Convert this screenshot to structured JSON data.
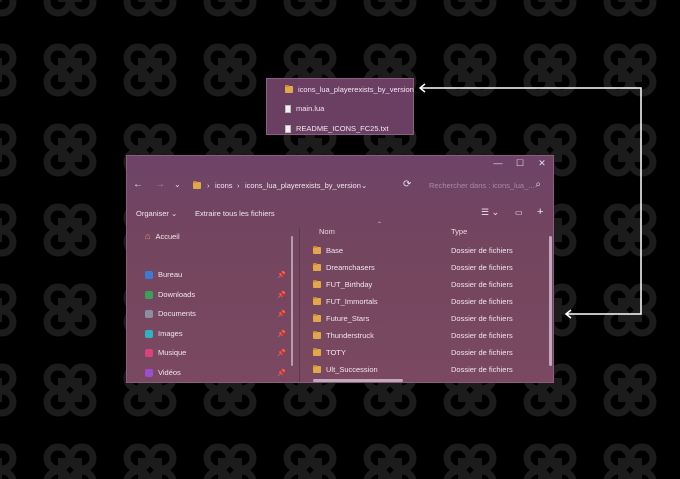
{
  "popup": {
    "items": [
      {
        "name": "icons_lua_playerexists_by_version",
        "icon": "folder-icon"
      },
      {
        "name": "main.lua",
        "icon": "file-icon"
      },
      {
        "name": "README_ICONS_FC25.txt",
        "icon": "file-icon"
      }
    ]
  },
  "window": {
    "breadcrumb": [
      "icons",
      "icons_lua_playerexists_by_version"
    ],
    "search_placeholder": "Rechercher dans : icons_lua_...",
    "toolbar": {
      "organize": "Organiser",
      "extract_all": "Extraire tous les fichiers"
    },
    "sidebar": [
      {
        "label": "Accueil",
        "icon": "home-icon",
        "color": "#e8a05a",
        "pinned": false
      },
      {
        "label": "Bureau",
        "icon": "desktop-icon",
        "color": "#3a7bd5",
        "pinned": true
      },
      {
        "label": "Downloads",
        "icon": "download-icon",
        "color": "#3aa05a",
        "pinned": true
      },
      {
        "label": "Documents",
        "icon": "documents-icon",
        "color": "#8a8fa0",
        "pinned": true
      },
      {
        "label": "Images",
        "icon": "images-icon",
        "color": "#2fb3c4",
        "pinned": true
      },
      {
        "label": "Musique",
        "icon": "music-icon",
        "color": "#d8437a",
        "pinned": true
      },
      {
        "label": "Vidéos",
        "icon": "videos-icon",
        "color": "#9a4fd0",
        "pinned": true
      }
    ],
    "columns": {
      "name": "Nom",
      "type": "Type"
    },
    "files": [
      {
        "name": "Base",
        "type": "Dossier de fichiers"
      },
      {
        "name": "Dreamchasers",
        "type": "Dossier de fichiers"
      },
      {
        "name": "FUT_Birthday",
        "type": "Dossier de fichiers"
      },
      {
        "name": "FUT_Immortals",
        "type": "Dossier de fichiers"
      },
      {
        "name": "Future_Stars",
        "type": "Dossier de fichiers"
      },
      {
        "name": "Thunderstruck",
        "type": "Dossier de fichiers"
      },
      {
        "name": "TOTY",
        "type": "Dossier de fichiers"
      },
      {
        "name": "Ult_Succession",
        "type": "Dossier de fichiers"
      }
    ]
  },
  "colors": {
    "accent_folder": "#e0a84a",
    "window_bg": "#74455f",
    "background": "#000000"
  }
}
